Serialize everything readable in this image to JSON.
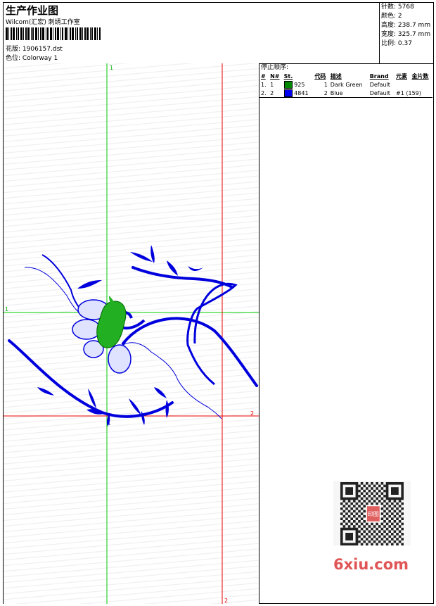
{
  "header": {
    "title": "生产作业图",
    "company": "Wilcom(汇宏) 刺绣工作室",
    "design_label": "花版:",
    "design_value": "1906157.dst",
    "colorway_label": "色位:",
    "colorway_value": "Colorway 1"
  },
  "stats": [
    {
      "label": "针数:",
      "value": "5768"
    },
    {
      "label": "颜色:",
      "value": "2"
    },
    {
      "label": "高度:",
      "value": "238.7 mm"
    },
    {
      "label": "宽度:",
      "value": "325.7 mm"
    },
    {
      "label": "比例:",
      "value": "0.37"
    }
  ],
  "guides": {
    "green_label": "1",
    "red_label": "2",
    "green_color": "#00cc00",
    "red_color": "#ee0000"
  },
  "stop_sequence": {
    "title": "停止顺序:",
    "columns": [
      "#",
      "N#",
      "St.",
      "代码",
      "描述",
      "Brand",
      "元素",
      "金片数"
    ],
    "rows": [
      {
        "idx": "1.",
        "n": "1",
        "color": "#008800",
        "st": "925",
        "code": "1",
        "desc": "Dark Green",
        "brand": "Default",
        "element": "",
        "sequins": ""
      },
      {
        "idx": "2.",
        "n": "2",
        "color": "#0000ee",
        "st": "4841",
        "code": "2",
        "desc": "Blue",
        "brand": "Default",
        "element": "#1 (159)",
        "sequins": ""
      }
    ]
  },
  "watermark": {
    "text": "6xiu.com",
    "qr_badge": "印图"
  },
  "colors": {
    "stitch_blue": "#0000dd",
    "stitch_green": "#00a000"
  }
}
